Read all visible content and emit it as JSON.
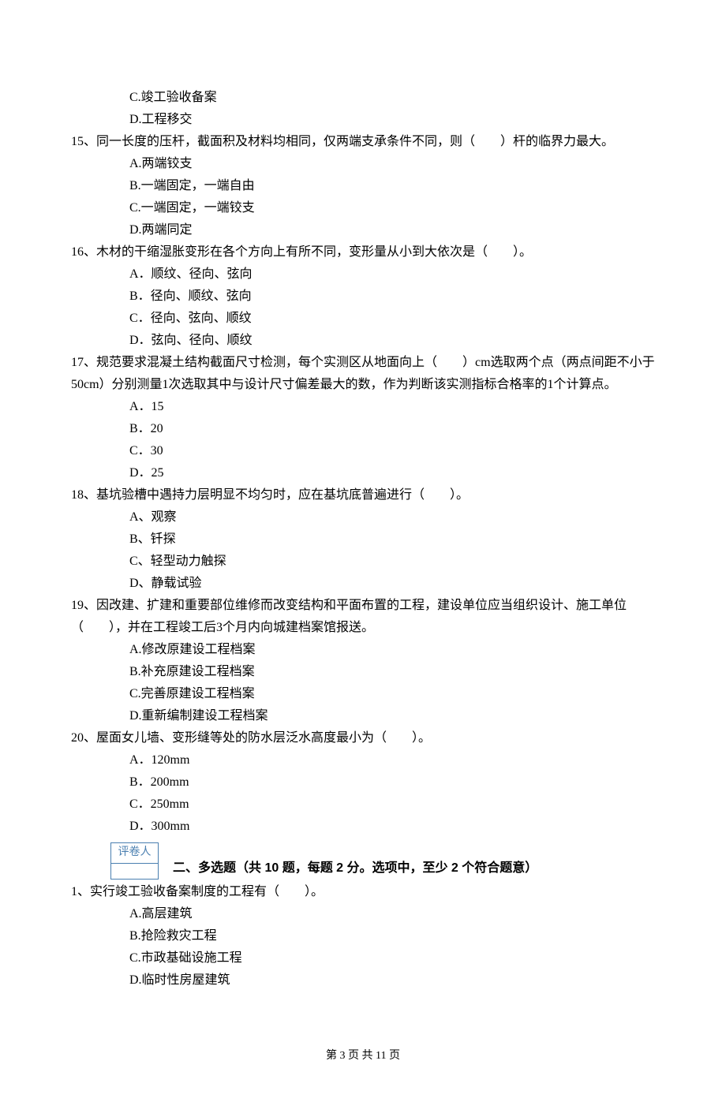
{
  "options_pre": [
    "C.竣工验收备案",
    "D.工程移交"
  ],
  "questions": [
    {
      "num": "15、",
      "text": "同一长度的压杆，截面积及材料均相同，仅两端支承条件不同，则（　　）杆的临界力最大。",
      "options": [
        "A.两端铰支",
        "B.一端固定，一端自由",
        "C.一端固定，一端铰支",
        "D.两端同定"
      ]
    },
    {
      "num": "16、",
      "text": "木材的干缩湿胀变形在各个方向上有所不同，变形量从小到大依次是（　　）。",
      "options": [
        "A．顺纹、径向、弦向",
        "B．径向、顺纹、弦向",
        "C．径向、弦向、顺纹",
        "D．弦向、径向、顺纹"
      ]
    },
    {
      "num": "17、",
      "text": "规范要求混凝土结构截面尺寸检测，每个实测区从地面向上（　　）cm选取两个点（两点间距不小于50cm）分别测量1次选取其中与设计尺寸偏差最大的数，作为判断该实测指标合格率的1个计算点。",
      "options": [
        "A．15",
        "B．20",
        "C．30",
        "D．25"
      ]
    },
    {
      "num": "18、",
      "text": "基坑验槽中遇持力层明显不均匀时，应在基坑底普遍进行（　　）。",
      "options": [
        "A、观察",
        "B、钎探",
        "C、轻型动力触探",
        "D、静载试验"
      ]
    },
    {
      "num": "19、",
      "text": "因改建、扩建和重要部位维修而改变结构和平面布置的工程，建设单位应当组织设计、施工单位（　　），并在工程竣工后3个月内向城建档案馆报送。",
      "options": [
        "A.修改原建设工程档案",
        "B.补充原建设工程档案",
        "C.完善原建设工程档案",
        "D.重新编制建设工程档案"
      ]
    },
    {
      "num": "20、",
      "text": "屋面女儿墙、变形缝等处的防水层泛水高度最小为（　　）。",
      "options": [
        "A．120mm",
        "B．200mm",
        "C．250mm",
        "D．300mm"
      ]
    }
  ],
  "grader_label": "评卷人",
  "section2_title": "二、多选题（共 10 题，每题 2 分。选项中，至少 2 个符合题意）",
  "section2_q1": {
    "num": "1、",
    "text": "实行竣工验收备案制度的工程有（　　）。",
    "options": [
      "A.高层建筑",
      "B.抢险救灾工程",
      "C.市政基础设施工程",
      "D.临时性房屋建筑"
    ]
  },
  "footer": {
    "prefix": "第 ",
    "page": "3",
    "mid": " 页 共 ",
    "total": "11",
    "suffix": " 页"
  }
}
